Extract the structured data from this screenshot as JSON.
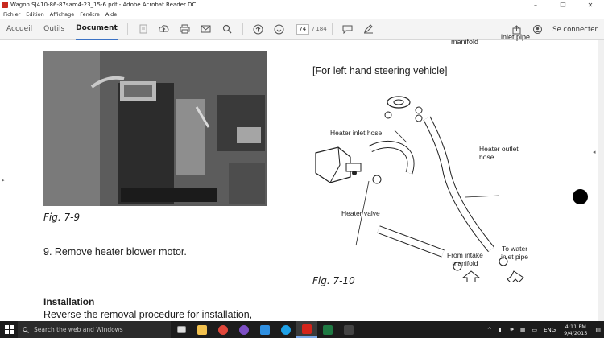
{
  "window": {
    "title": "Wagon SJ410-86-87sam4-23_15-6.pdf - Adobe Acrobat Reader DC",
    "controls": [
      "–",
      "❐",
      "✕"
    ]
  },
  "menu": [
    "Fichier",
    "Edition",
    "Affichage",
    "Fenêtre",
    "Aide"
  ],
  "toolbar": {
    "tabs": [
      "Accueil",
      "Outils",
      "Document"
    ],
    "active_tab": "Document",
    "page_number": "74",
    "page_total": "/ 184",
    "login_label": "Se connecter"
  },
  "document": {
    "top_fragment_left": "manifold",
    "top_fragment_right": "inlet pipe",
    "fig_7_9": "Fig. 7-9",
    "step_9": "9.  Remove heater blower motor.",
    "installation_heading": "Installation",
    "installation_text": "Reverse the removal procedure for installation,",
    "diagram_heading": "[For left hand steering vehicle]",
    "fig_7_10": "Fig. 7-10",
    "labels": {
      "heater_inlet_hose": "Heater inlet hose",
      "heater_outlet_hose_1": "Heater outlet",
      "heater_outlet_hose_2": "hose",
      "heater_valve": "Heater valve",
      "from_intake_1": "From intake",
      "from_intake_2": "manifold",
      "to_water_1": "To water",
      "to_water_2": "inlet pipe"
    }
  },
  "taskbar": {
    "search_placeholder": "Search the web and Windows",
    "language": "ENG",
    "time": "4:11 PM",
    "date": "9/4/2015",
    "apps": [
      {
        "name": "task-view",
        "color": "#dddddd"
      },
      {
        "name": "file-explorer",
        "color": "#f2c14e"
      },
      {
        "name": "chrome",
        "color": "#e0463a"
      },
      {
        "name": "viber",
        "color": "#7d4fc4"
      },
      {
        "name": "network",
        "color": "#2f8fe0"
      },
      {
        "name": "skype",
        "color": "#1ea0e6"
      },
      {
        "name": "acrobat",
        "color": "#d4241a"
      },
      {
        "name": "excel",
        "color": "#1f7a43"
      },
      {
        "name": "app-dark",
        "color": "#444444"
      }
    ]
  },
  "colors": {
    "accent": "#3b72c4",
    "taskbar": "#1c1c1c",
    "toolbar": "#f4f4f4"
  }
}
